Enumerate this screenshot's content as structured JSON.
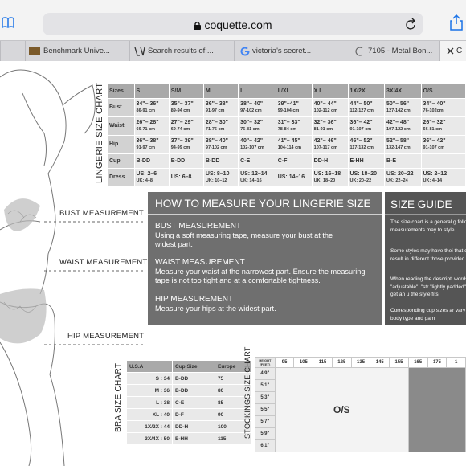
{
  "browser": {
    "url": "coquette.com",
    "tabs": [
      {
        "label": "Benchmark Unive...",
        "icon": "benchmark-icon"
      },
      {
        "label": "Search results of:...",
        "icon": "lv-icon"
      },
      {
        "label": "victoria's secret...",
        "icon": "google-icon"
      },
      {
        "label": "7105 - Metal Bon...",
        "icon": "coquette-icon"
      },
      {
        "label": "C",
        "icon": "close-icon"
      }
    ]
  },
  "lingerie_chart": {
    "title": "LINGERIE SIZE CHART",
    "headers": [
      "Sizes",
      "S",
      "S/M",
      "M",
      "L",
      "L/XL",
      "X L",
      "1X/2X",
      "3X/4X",
      "O/S",
      ""
    ],
    "rows": [
      {
        "label": "Bust",
        "cells": [
          [
            "34\"– 36\"",
            "86-91 cm"
          ],
          [
            "35\"– 37\"",
            "89-94 cm"
          ],
          [
            "36\"– 38\"",
            "91-97 cm"
          ],
          [
            "38\"– 40\"",
            "97-102 cm"
          ],
          [
            "39\"–41\"",
            "99-104 cm"
          ],
          [
            "40\"– 44\"",
            "102-112 cm"
          ],
          [
            "44\"– 50\"",
            "112-127 cm"
          ],
          [
            "50\"– 56\"",
            "127-142 cm"
          ],
          [
            "34\"– 40\"",
            "76-102cm"
          ],
          [
            ""
          ]
        ]
      },
      {
        "label": "Waist",
        "cells": [
          [
            "26\"– 28\"",
            "66-71 cm"
          ],
          [
            "27\"– 29\"",
            "69-74 cm"
          ],
          [
            "28\"– 30\"",
            "71-76 cm"
          ],
          [
            "30\"– 32\"",
            "76-81 cm"
          ],
          [
            "31\"– 33\"",
            "78-84 cm"
          ],
          [
            "32\"– 36\"",
            "81-91 cm"
          ],
          [
            "36\"– 42\"",
            "91-107 cm"
          ],
          [
            "42\"– 48\"",
            "107-122 cm"
          ],
          [
            "26\"– 32\"",
            "66-81 cm"
          ],
          [
            ""
          ]
        ]
      },
      {
        "label": "Hip",
        "cells": [
          [
            "36\"– 38\"",
            "91-97 cm"
          ],
          [
            "37\"– 39\"",
            "94-99 cm"
          ],
          [
            "38\"– 40\"",
            "97-102 cm"
          ],
          [
            "40\"– 42\"",
            "102-107 cm"
          ],
          [
            "41\"– 45\"",
            "104-114 cm"
          ],
          [
            "42\"– 46\"",
            "107-117 cm"
          ],
          [
            "46\"– 52\"",
            "117-132 cm"
          ],
          [
            "52\"– 58\"",
            "132-147 cm"
          ],
          [
            "36\"– 42\"",
            "91-107 cm"
          ],
          [
            ""
          ]
        ]
      },
      {
        "label": "Cup",
        "cells": [
          [
            "B-DD"
          ],
          [
            "B-DD"
          ],
          [
            "B-DD"
          ],
          [
            "C-E"
          ],
          [
            "C-F"
          ],
          [
            "DD-H"
          ],
          [
            "E-HH"
          ],
          [
            "B-E"
          ],
          [
            ""
          ],
          [
            ""
          ]
        ]
      },
      {
        "label": "Dress",
        "cells": [
          [
            "US: 2–6",
            "UK: 4–8"
          ],
          [
            "US: 6–8"
          ],
          [
            "US: 8–10",
            "UK: 10–12"
          ],
          [
            "US: 12–14",
            "UK: 14–16"
          ],
          [
            "US: 14–16"
          ],
          [
            "US: 16–18",
            "UK: 18–20"
          ],
          [
            "US: 18–20",
            "UK: 20–22"
          ],
          [
            "US: 20–22",
            "UK: 22–24"
          ],
          [
            "US: 2–12",
            "UK: 4–14"
          ],
          [
            ""
          ]
        ]
      }
    ]
  },
  "measurements": {
    "bust": "BUST MEASUREMENT",
    "waist": "WAIST MEASUREMENT",
    "hip": "HIP MEASUREMENT"
  },
  "how_to": {
    "title": "HOW TO MEASURE YOUR LINGERIE SIZE",
    "bust_heading": "BUST MEASUREMENT",
    "bust_text": "Using a soft measuring tape, measure your bust at the widest part.",
    "waist_heading": "WAIST MEASUREMENT",
    "waist_text": "Measure your waist at the narrowest part. Ensure the measuring tape is not too tight and at a comfortable tightness.",
    "hip_heading": "HIP MEASUREMENT",
    "hip_text": "Measure your hips at the widest part."
  },
  "size_guide": {
    "title": "SIZE GUIDE",
    "p1": "The size chart is a general g follow, measurements may to style.",
    "p2": "Some styles may have thei that could result in different those provided.",
    "p3": "When reading the descripti words like \"adjustable\". \"str \"lightly padded\" to get an u the style fits.",
    "p4": "Corresponding cup sizes ar vary by body type and gam"
  },
  "bra_chart": {
    "title": "BRA SIZE CHART",
    "headers": [
      "U.S.A",
      "Cup Size",
      "Europe"
    ],
    "rows": [
      [
        "S : 34",
        "B-DD",
        "75"
      ],
      [
        "M : 36",
        "B-DD",
        "80"
      ],
      [
        "L : 38",
        "C-E",
        "85"
      ],
      [
        "XL : 40",
        "D-F",
        "90"
      ],
      [
        "1X/2X : 44",
        "DD-H",
        "100"
      ],
      [
        "3X/4X : 50",
        "E-HH",
        "115"
      ]
    ]
  },
  "stockings_chart": {
    "title": "STOCKINGS SIZE CHART",
    "corner": "HEIGHT (FEET)",
    "weights": [
      "95",
      "105",
      "115",
      "125",
      "135",
      "145",
      "155",
      "165",
      "175",
      "1"
    ],
    "heights": [
      "4'9\"",
      "5'1\"",
      "5'3\"",
      "5'5\"",
      "5'7\"",
      "5'9\"",
      "6'1\""
    ],
    "size": "O/S"
  }
}
